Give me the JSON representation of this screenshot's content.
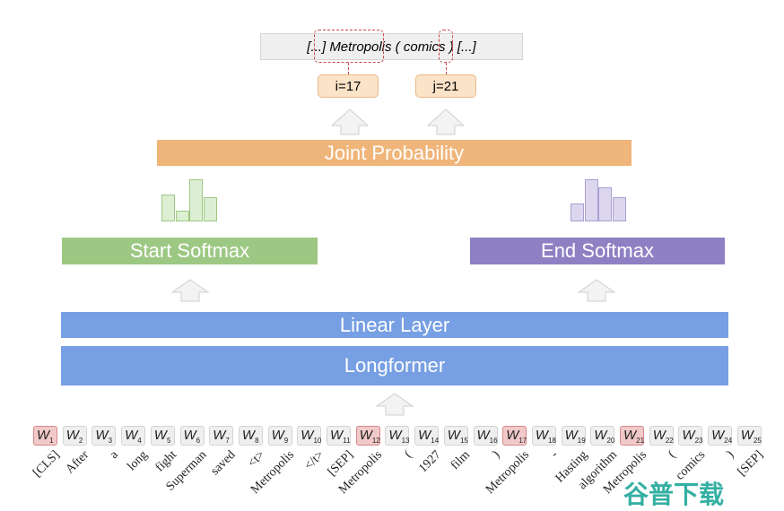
{
  "span_text": {
    "prefix": "[...] ",
    "start": "Metropolis",
    "mid": " ( comics ",
    "end": ")",
    "suffix": " [...]"
  },
  "start_index": "i=17",
  "end_index": "j=21",
  "joint": "Joint Probability",
  "start_softmax": "Start Softmax",
  "end_softmax": "End Softmax",
  "linear": "Linear Layer",
  "longformer": "Longformer",
  "start_hist": [
    30,
    12,
    47,
    27
  ],
  "end_hist": [
    20,
    47,
    38,
    27
  ],
  "colors": {
    "joint": "#f0b57a",
    "start": "#9dc884",
    "end": "#8e80c3",
    "encoder": "#779fe3",
    "highlight": "#f2c9c9"
  },
  "tokens": [
    "[CLS]",
    "After",
    "a",
    "long",
    "fight",
    "Superman",
    "saved",
    "<t>",
    "Metropolis",
    "</t>",
    "[SEP]",
    "Metropolis",
    "(",
    "1927",
    "film",
    ")",
    "Metropolis",
    "-",
    "Hasting",
    "algorithm",
    "Metropolis",
    "(",
    "comics",
    ")",
    "[SEP]"
  ],
  "highlighted": [
    1,
    12,
    17,
    21
  ],
  "watermark": "谷普下载"
}
